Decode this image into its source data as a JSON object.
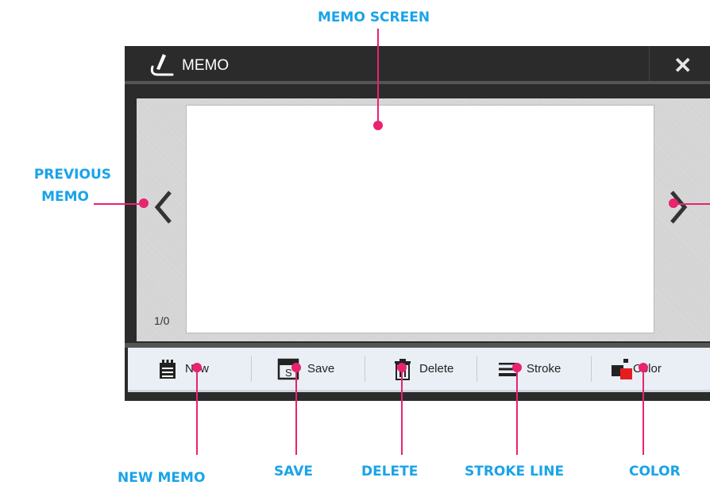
{
  "callouts": {
    "memo_screen": "MEMO SCREEN",
    "previous_memo_line1": "PREVIOUS",
    "previous_memo_line2": "MEMO",
    "new_memo": "NEW MEMO",
    "save": "SAVE",
    "delete": "DELETE",
    "stroke_line": "STROKE LINE",
    "color": "COLOR"
  },
  "window": {
    "title": "MEMO",
    "close_glyph": "✕",
    "page_counter": "1/0"
  },
  "toolbar": {
    "new_label": "New",
    "save_label": "Save",
    "delete_label": "Delete",
    "stroke_label": "Stroke",
    "color_label": "Color"
  },
  "colors": {
    "callout_text": "#1aa3e8",
    "callout_marker": "#e8236f",
    "window_frame": "#2b2b2b",
    "toolbar_bg": "#eaeff5",
    "color_swatch": "#e41e1e"
  },
  "icons": [
    "pen-icon",
    "close-icon",
    "chevron-left-icon",
    "chevron-right-icon",
    "notepad-icon",
    "save-icon",
    "trash-icon",
    "stroke-lines-icon",
    "color-palette-icon"
  ]
}
